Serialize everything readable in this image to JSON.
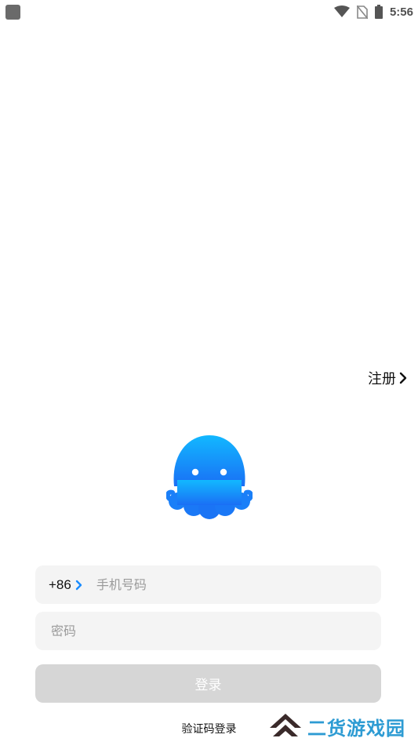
{
  "status_bar": {
    "time": "5:56",
    "icons": [
      "notification-square-icon",
      "wifi-icon",
      "no-sim-icon",
      "battery-icon"
    ]
  },
  "register": {
    "label": "注册",
    "icon": "chevron-right-icon"
  },
  "logo": {
    "icon": "octopus-mascot-icon",
    "color": "#1a8cff"
  },
  "phone_field": {
    "country_code": "+86",
    "placeholder": "手机号码",
    "value": ""
  },
  "password_field": {
    "placeholder": "密码",
    "value": ""
  },
  "login_button": {
    "label": "登录"
  },
  "sms_login": {
    "label": "验证码登录"
  },
  "watermark": {
    "text": "二货游戏园",
    "text_color": "#2d9bd3",
    "logo_color": "#3a2a2a"
  }
}
